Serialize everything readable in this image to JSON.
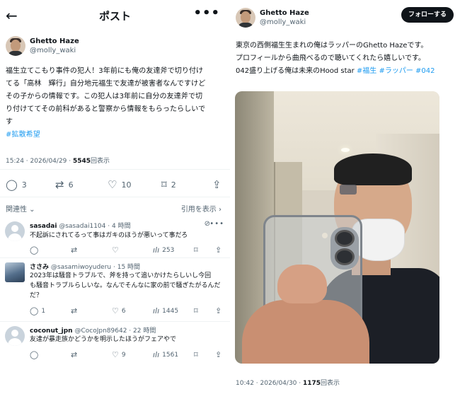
{
  "left": {
    "header": {
      "back_glyph": "←",
      "title": "ポスト",
      "more_glyph": "•••"
    },
    "author": {
      "display_name": "Ghetto Haze",
      "handle": "@molly_waki"
    },
    "post_lines": [
      "福生立てこもり事件の犯人！3年前にも俺の友達斧で切り付け",
      "てる「高林　輝行」自分地元福生で友達が被害者なんですけど",
      "その子からの情報です。この犯人は3年前に自分の友達斧で切",
      "り付けててその前科があると警察から情報をもらったらしいで",
      "す"
    ],
    "post_hashtag": "#拡散希望",
    "meta": {
      "time": "15:24 · 2026/04/29 · ",
      "views": "5545",
      "views_label": "回表示"
    },
    "actions": {
      "reply": {
        "icon": "reply-icon",
        "glyph": "◯",
        "count": "3"
      },
      "retweet": {
        "icon": "retweet-icon",
        "glyph": "⇄",
        "count": "6"
      },
      "like": {
        "icon": "heart-icon",
        "glyph": "♡",
        "count": "10"
      },
      "bookmark": {
        "icon": "bookmark-icon",
        "glyph": "⌑",
        "count": "2"
      },
      "share": {
        "icon": "share-icon",
        "glyph": "⇪"
      }
    },
    "sort": {
      "label": "関連性 ⌄",
      "quotes": "引用を表示 ›"
    },
    "replies": [
      {
        "name": "sasadai",
        "handle": "@sasadai1104",
        "time": "· 4 時間",
        "lines": [
          "不起訴にされてるって事はガキのほうが悪いって事だろ"
        ],
        "reply_count": "",
        "retweet_count": "",
        "like_count": "",
        "views": "253"
      },
      {
        "name": "ささみ",
        "handle": "@sasamiwoyuderu",
        "time": "· 15 時間",
        "lines": [
          "2023年は騒音トラブルで、斧を持って追いかけたらしいし今回",
          "も騒音トラブルらしいな。なんでそんなに家の前で騒ぎたがるんだ",
          "だ？"
        ],
        "reply_count": "1",
        "retweet_count": "",
        "like_count": "6",
        "views": "1445"
      },
      {
        "name": "coconut_jpn",
        "handle": "@CocoJpn89642",
        "time": "· 22 時間",
        "lines": [
          "友達が暴走族かどうかを明示したほうがフェアやで"
        ],
        "reply_count": "",
        "retweet_count": "",
        "like_count": "9",
        "views": "1561"
      }
    ],
    "reply_glyphs": {
      "more": "•••",
      "grok": "⊘",
      "reply": "◯",
      "retweet": "⇄",
      "like": "♡",
      "views": "ılı",
      "bookmark": "⌑",
      "share": "⇪"
    }
  },
  "right": {
    "author": {
      "display_name": "Ghetto Haze",
      "handle": "@molly_waki"
    },
    "follow_label": "フォローする",
    "post_lines": [
      "東京の西側福生生まれの俺はラッパーのGhetto Hazeです。",
      "プロフィールから曲飛べるので聴いてくれたら嬉しいです。"
    ],
    "post_line3_prefix": "042盛り上げる俺は未来のHood star ",
    "post_line3_tags": "#福生 #ラッパー",
    "post_line3_suffix": " #042",
    "meta": {
      "time": "10:42 · 2026/04/30 · ",
      "views": "1175",
      "views_label": "回表示"
    }
  }
}
